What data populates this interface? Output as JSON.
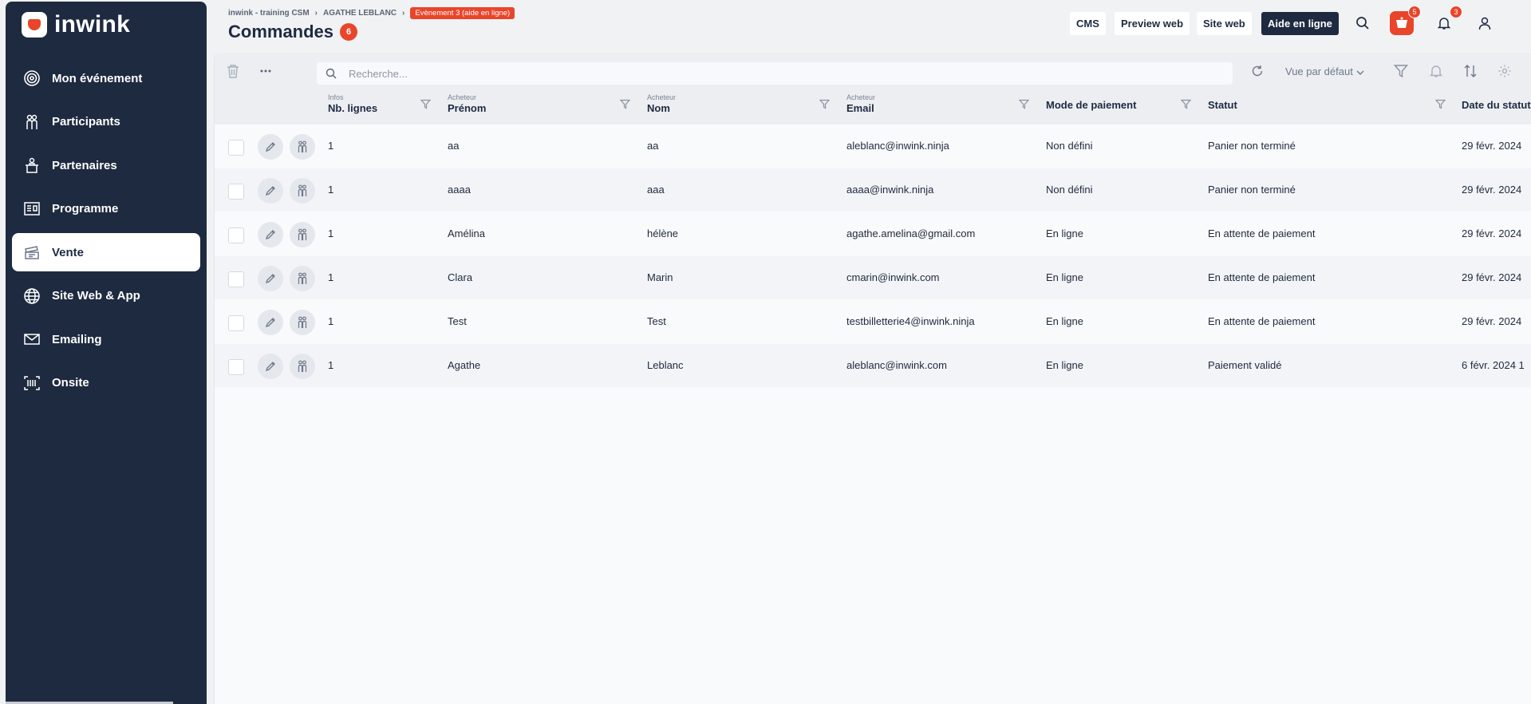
{
  "brand": {
    "name": "inwink",
    "accent": "#e8452b",
    "sidebar_bg": "#1e2a40"
  },
  "sidebar": {
    "items": [
      {
        "label": "Mon événement",
        "icon": "target-icon",
        "active": false
      },
      {
        "label": "Participants",
        "icon": "people-icon",
        "active": false
      },
      {
        "label": "Partenaires",
        "icon": "booth-icon",
        "active": false
      },
      {
        "label": "Programme",
        "icon": "presentation-icon",
        "active": false
      },
      {
        "label": "Vente",
        "icon": "ticket-icon",
        "active": true
      },
      {
        "label": "Site Web & App",
        "icon": "globe-icon",
        "active": false
      },
      {
        "label": "Emailing",
        "icon": "mail-icon",
        "active": false
      },
      {
        "label": "Onsite",
        "icon": "barcode-icon",
        "active": false
      }
    ]
  },
  "header": {
    "breadcrumb": [
      "inwink - training CSM",
      "AGATHE LEBLANC"
    ],
    "event_tag": "Evènement 3 (aide en ligne)",
    "title": "Commandes",
    "title_count": "6",
    "buttons": {
      "cms": "CMS",
      "preview": "Preview web",
      "site": "Site web",
      "help": "Aide en ligne"
    },
    "cart_badge": "5",
    "bell_badge": "3"
  },
  "toolbar": {
    "search_placeholder": "Recherche...",
    "view_label": "Vue par défaut"
  },
  "table": {
    "columns": [
      {
        "sub": "Infos",
        "label": "Nb. lignes"
      },
      {
        "sub": "Acheteur",
        "label": "Prénom"
      },
      {
        "sub": "Acheteur",
        "label": "Nom"
      },
      {
        "sub": "Acheteur",
        "label": "Email"
      },
      {
        "sub": "",
        "label": "Mode de paiement"
      },
      {
        "sub": "",
        "label": "Statut"
      },
      {
        "sub": "",
        "label": "Date du statut"
      }
    ],
    "rows": [
      {
        "lines": "1",
        "firstname": "aa",
        "lastname": "aa",
        "email": "aleblanc@inwink.ninja",
        "payment": "Non défini",
        "status": "Panier non terminé",
        "date": "29 févr. 2024"
      },
      {
        "lines": "1",
        "firstname": "aaaa",
        "lastname": "aaa",
        "email": "aaaa@inwink.ninja",
        "payment": "Non défini",
        "status": "Panier non terminé",
        "date": "29 févr. 2024"
      },
      {
        "lines": "1",
        "firstname": "Amélina",
        "lastname": "hélène",
        "email": "agathe.amelina@gmail.com",
        "payment": "En ligne",
        "status": "En attente de paiement",
        "date": "29 févr. 2024"
      },
      {
        "lines": "1",
        "firstname": "Clara",
        "lastname": "Marin",
        "email": "cmarin@inwink.com",
        "payment": "En ligne",
        "status": "En attente de paiement",
        "date": "29 févr. 2024"
      },
      {
        "lines": "1",
        "firstname": "Test",
        "lastname": "Test",
        "email": "testbilletterie4@inwink.ninja",
        "payment": "En ligne",
        "status": "En attente de paiement",
        "date": "29 févr. 2024"
      },
      {
        "lines": "1",
        "firstname": "Agathe",
        "lastname": "Leblanc",
        "email": "aleblanc@inwink.com",
        "payment": "En ligne",
        "status": "Paiement validé",
        "date": "6 févr. 2024 1"
      }
    ]
  }
}
